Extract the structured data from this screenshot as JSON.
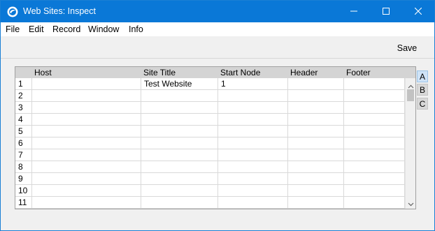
{
  "window": {
    "title": "Web Sites: Inspect",
    "icons": {
      "app": "app-logo-icon",
      "minimize": "minimize-icon",
      "maximize": "maximize-icon",
      "close": "close-icon"
    }
  },
  "menu": {
    "items": [
      "File",
      "Edit",
      "Record",
      "Window",
      "Info"
    ]
  },
  "toolbar": {
    "save_label": "Save"
  },
  "grid": {
    "columns": [
      "Host",
      "Site Title",
      "Start Node",
      "Header",
      "Footer"
    ],
    "rows": [
      {
        "num": "1",
        "host": "",
        "site_title": "Test Website",
        "start_node": "1",
        "header": "",
        "footer": ""
      },
      {
        "num": "2",
        "host": "",
        "site_title": "",
        "start_node": "",
        "header": "",
        "footer": ""
      },
      {
        "num": "3",
        "host": "",
        "site_title": "",
        "start_node": "",
        "header": "",
        "footer": ""
      },
      {
        "num": "4",
        "host": "",
        "site_title": "",
        "start_node": "",
        "header": "",
        "footer": ""
      },
      {
        "num": "5",
        "host": "",
        "site_title": "",
        "start_node": "",
        "header": "",
        "footer": ""
      },
      {
        "num": "6",
        "host": "",
        "site_title": "",
        "start_node": "",
        "header": "",
        "footer": ""
      },
      {
        "num": "7",
        "host": "",
        "site_title": "",
        "start_node": "",
        "header": "",
        "footer": ""
      },
      {
        "num": "8",
        "host": "",
        "site_title": "",
        "start_node": "",
        "header": "",
        "footer": ""
      },
      {
        "num": "9",
        "host": "",
        "site_title": "",
        "start_node": "",
        "header": "",
        "footer": ""
      },
      {
        "num": "10",
        "host": "",
        "site_title": "",
        "start_node": "",
        "header": "",
        "footer": ""
      },
      {
        "num": "11",
        "host": "",
        "site_title": "",
        "start_node": "",
        "header": "",
        "footer": ""
      }
    ]
  },
  "side_tabs": [
    "A",
    "B",
    "C"
  ],
  "colors": {
    "titlebar": "#0a78d7",
    "grid_header": "#d4d4d4",
    "active_tab": "#cfe3f7"
  }
}
